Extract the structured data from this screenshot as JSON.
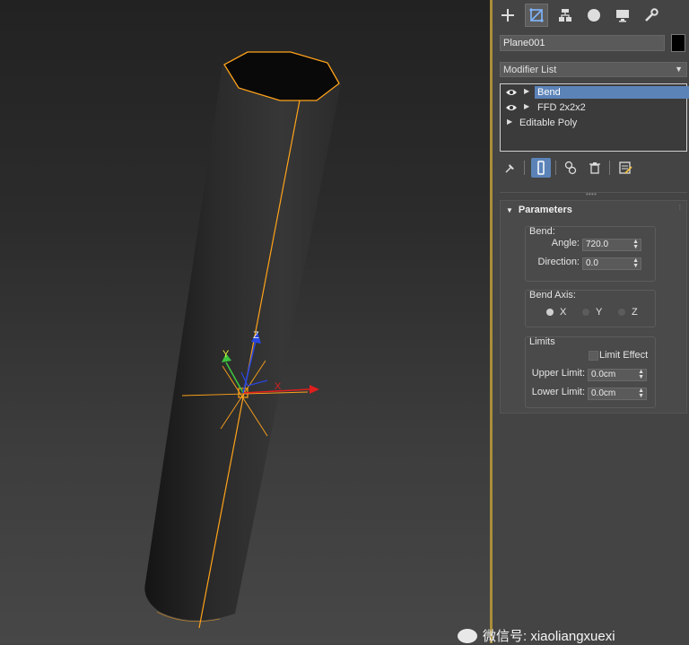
{
  "command_panel": {
    "tabs": [
      {
        "icon": "create-icon"
      },
      {
        "icon": "modify-icon",
        "active": true
      },
      {
        "icon": "hierarchy-icon"
      },
      {
        "icon": "motion-icon"
      },
      {
        "icon": "display-icon"
      },
      {
        "icon": "utilities-icon"
      }
    ],
    "object_name": "Plane001",
    "object_color": "#000000",
    "modifier_list": "Modifier List",
    "stack": [
      {
        "label": "Bend",
        "selected": true
      },
      {
        "label": "FFD 2x2x2",
        "selected": false
      },
      {
        "label": "Editable Poly",
        "selected": false
      }
    ]
  },
  "parameters": {
    "title": "Parameters",
    "bend_group": "Bend:",
    "angle_label": "Angle:",
    "angle_value": "720.0",
    "direction_label": "Direction:",
    "direction_value": "0.0",
    "axis_group": "Bend Axis:",
    "axes": [
      {
        "label": "X",
        "checked": true
      },
      {
        "label": "Y",
        "checked": false
      },
      {
        "label": "Z",
        "checked": false
      }
    ],
    "limits_group": "Limits",
    "limit_effect_label": "Limit Effect",
    "upper_limit_label": "Upper Limit:",
    "upper_limit_value": "0.0cm",
    "lower_limit_label": "Lower Limit:",
    "lower_limit_value": "0.0cm"
  },
  "viewport": {
    "gizmo": {
      "x": "X",
      "y": "Y",
      "z": "Z"
    }
  },
  "watermark": "微信号: xiaoliangxuexi",
  "colors": {
    "selection": "#ffa31a",
    "accent": "#5b83b8",
    "axis_x": "#e01e1e",
    "axis_y": "#3ec23e",
    "axis_z": "#2846e0"
  }
}
